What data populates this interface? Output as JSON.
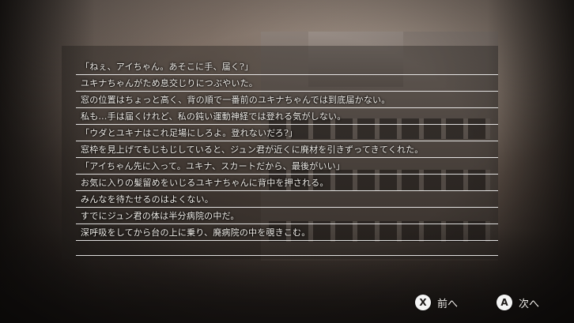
{
  "dialogue": {
    "lines": [
      "「ねぇ、アイちゃん。あそこに手、届く?」",
      "ユキナちゃんがため息交じりにつぶやいた。",
      "窓の位置はちょっと高く、背の順で一番前のユキナちゃんでは到底届かない。",
      "私も…手は届くけれど、私の鈍い運動神経では登れる気がしない。",
      "「ウダとユキナはこれ足場にしろよ。登れないだろ?」",
      "窓枠を見上げてもじもじしていると、ジュン君が近くに廃材を引きずってきてくれた。",
      "「アイちゃん先に入って。ユキナ、スカートだから、最後がいい」",
      "お気に入りの髪留めをいじるユキナちゃんに背中を押される。",
      "みんなを待たせるのはよくない。",
      "すでにジュン君の体は半分病院の中だ。",
      "深呼吸をしてから台の上に乗り、廃病院の中を覗きこむ。"
    ]
  },
  "controls": {
    "prev": {
      "glyph": "X",
      "label": "前へ"
    },
    "next": {
      "glyph": "A",
      "label": "次へ"
    }
  }
}
